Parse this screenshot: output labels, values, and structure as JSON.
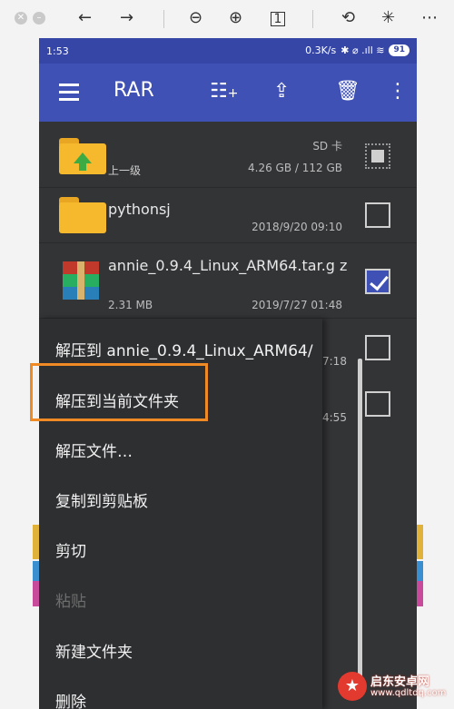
{
  "status": {
    "time": "1:53",
    "net": "0.3K/s",
    "icons": "✱ ⌀ .ıll ≋",
    "battery": "91"
  },
  "appbar": {
    "title": "RAR"
  },
  "files": [
    {
      "name": "上一级",
      "meta": "SD 卡",
      "size": "4.26 GB / 112 GB"
    },
    {
      "name": "pythonsj",
      "date": "2018/9/20 09:10"
    },
    {
      "name": "annie_0.9.4_Linux_ARM64.tar.g z",
      "size": "2.31 MB",
      "date": "2019/7/27 01:48"
    }
  ],
  "under_times": [
    "7:18",
    "4:55"
  ],
  "menu": {
    "items": [
      "解压到 annie_0.9.4_Linux_ARM64/",
      "解压到当前文件夹",
      "解压文件…",
      "复制到剪贴板",
      "剪切",
      "粘贴",
      "新建文件夹",
      "删除"
    ]
  },
  "watermark": {
    "title": "启东安卓网",
    "url": "www.qdltdq.com"
  },
  "colors": {
    "appbar": "#3f51b5",
    "statusbar": "#3646a6",
    "highlight": "#f08a24",
    "folder": "#f6b92e"
  }
}
